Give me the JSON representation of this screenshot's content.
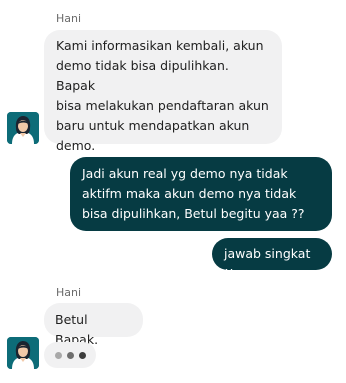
{
  "colors": {
    "incoming_bubble": "#f1f1f2",
    "outgoing_bubble": "#063b43",
    "sender_name": "#6b6b6b",
    "avatar_bg": "#0d6c78"
  },
  "messages": [
    {
      "sender": "Hani",
      "direction": "incoming",
      "lines": [
        "Kami informasikan kembali, akun",
        "demo tidak bisa dipulihkan. Bapak",
        "bisa melakukan pendaftaran akun",
        "baru untuk mendapatkan akun",
        "demo."
      ]
    },
    {
      "direction": "outgoing",
      "lines": [
        "Jadi akun real yg demo nya tidak",
        "aktifm maka akun demo nya tidak",
        "bisa dipulihkan,  Betul begitu yaa ??"
      ]
    },
    {
      "direction": "outgoing",
      "lines": [
        "jawab singkat !!"
      ]
    },
    {
      "sender": "Hani",
      "direction": "incoming",
      "lines": [
        "Betul Bapak."
      ]
    }
  ],
  "typing_indicator": {
    "dot_colors": [
      "#a8a8a8",
      "#6e6e6e",
      "#3c3c3c"
    ]
  },
  "avatar_icon": "agent-avatar-icon"
}
